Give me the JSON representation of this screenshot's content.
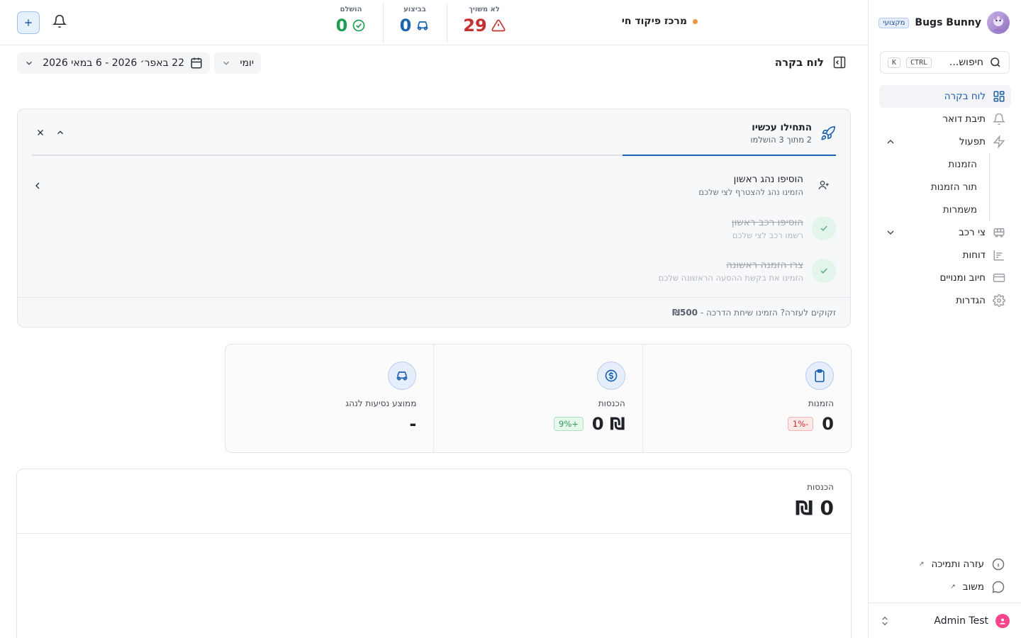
{
  "sidebar": {
    "brand_name": "Bugs Bunny",
    "plan_badge": "מקצועי",
    "search": {
      "placeholder": "חיפוש...",
      "kbd_ctrl": "CTRL",
      "kbd_k": "K"
    },
    "items": [
      {
        "label": "לוח בקרה",
        "icon": "dashboard-icon",
        "active": true
      },
      {
        "label": "תיבת דואר",
        "icon": "bell-icon"
      },
      {
        "label": "תפעול",
        "icon": "bolt-icon",
        "expanded": true,
        "children": [
          {
            "label": "הזמנות"
          },
          {
            "label": "תור הזמנות"
          },
          {
            "label": "משמרות"
          }
        ]
      },
      {
        "label": "צי רכב",
        "icon": "bus-icon",
        "expanded": false
      },
      {
        "label": "דוחות",
        "icon": "chart-icon"
      },
      {
        "label": "חיוב ומנויים",
        "icon": "credit-card-icon"
      },
      {
        "label": "הגדרות",
        "icon": "gear-icon"
      }
    ],
    "bottom": [
      {
        "label": "עזרה ותמיכה",
        "icon": "info-icon"
      },
      {
        "label": "משוב",
        "icon": "chat-icon"
      }
    ],
    "user": {
      "name": "Admin Test"
    }
  },
  "topbar": {
    "title": "מרכז פיקוד חי",
    "stats": [
      {
        "label": "לא משויך",
        "value": "29",
        "color": "#c53030",
        "icon": "warning-icon"
      },
      {
        "label": "בביצוע",
        "value": "0",
        "color": "#1d63b0",
        "icon": "car-icon"
      },
      {
        "label": "הושלם",
        "value": "0",
        "color": "#1f9d55",
        "icon": "check-circle-icon"
      }
    ]
  },
  "page": {
    "title": "לוח בקרה",
    "period": "יומי",
    "date_range": "22 באפר׳ 2026 - 6 במאי 2026"
  },
  "onboarding": {
    "title": "התחילו עכשיו",
    "progress_text": "2 מתוך 3 הושלמו",
    "progress_fraction": 0.2667,
    "steps": [
      {
        "title": "הוסיפו נהג ראשון",
        "desc": "הזמינו נהג להצטרף לצי שלכם",
        "done": false
      },
      {
        "title": "הוסיפו רכב ראשון",
        "desc": "רשמו רכב לצי שלכם",
        "done": true
      },
      {
        "title": "צרו הזמנה ראשונה",
        "desc": "הזמינו את בקשת ההסעה הראשונה שלכם",
        "done": true
      }
    ],
    "footer_text": "זקוקים לעזרה? הזמינו שיחת הדרכה -",
    "footer_price": "₪500"
  },
  "kpis": [
    {
      "label": "הזמנות",
      "value": "0",
      "change": "-1%",
      "trend": "neg",
      "icon": "clipboard-icon"
    },
    {
      "label": "הכנסות",
      "value": "₪ 0",
      "change": "+9%",
      "trend": "pos",
      "icon": "dollar-icon"
    },
    {
      "label": "ממוצע נסיעות לנהג",
      "value": "-",
      "change": "",
      "trend": "",
      "icon": "car-icon"
    }
  ],
  "revenue": {
    "label": "הכנסות",
    "value": "₪ 0"
  },
  "colors": {
    "accent": "#1d63b0",
    "danger": "#c53030",
    "success": "#1f9d55",
    "warning_dot": "#f5923e"
  }
}
